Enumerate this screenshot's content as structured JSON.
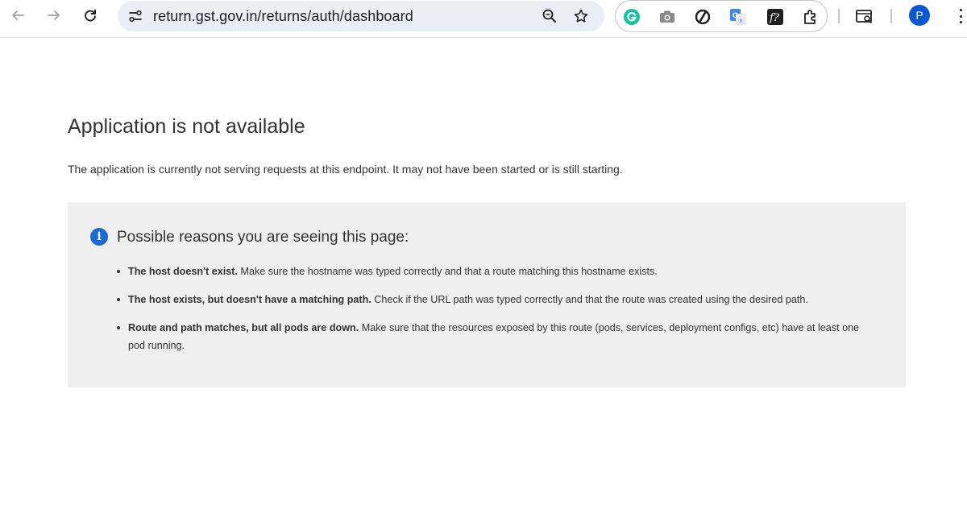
{
  "browser": {
    "url": "return.gst.gov.in/returns/auth/dashboard",
    "avatar_initial": "P",
    "nav_icons": [
      "back-arrow-icon",
      "forward-arrow-icon",
      "reload-icon"
    ],
    "omnibox_icons": [
      "site-info-icon",
      "zoom-icon",
      "bookmark-star-icon"
    ],
    "extensions": [
      "grammarly-icon",
      "camera-icon",
      "speed-dial-icon",
      "google-translate-icon",
      "fonts-ninja-icon",
      "extensions-puzzle-icon"
    ],
    "toolbar_icons": [
      "search-tabs-icon",
      "profile-avatar",
      "menu-dots-icon"
    ]
  },
  "page": {
    "title": "Application is not available",
    "description": "The application is currently not serving requests at this endpoint. It may not have been started or is still starting.",
    "panel": {
      "icon": "info-icon",
      "title": "Possible reasons you are seeing this page:",
      "reasons": [
        {
          "strong": "The host doesn't exist.",
          "text": " Make sure the hostname was typed correctly and that a route matching this hostname exists."
        },
        {
          "strong": "The host exists, but doesn't have a matching path.",
          "text": " Check if the URL path was typed correctly and that the route was created using the desired path."
        },
        {
          "strong": "Route and path matches, but all pods are down.",
          "text": " Make sure that the resources exposed by this route (pods, services, deployment configs, etc) have at least one pod running."
        }
      ]
    }
  },
  "colors": {
    "info_blue": "#1a6ad4",
    "panel_bg": "#efefef",
    "omnibox_bg": "#e9eef6",
    "avatar_bg": "#0b57d0"
  }
}
